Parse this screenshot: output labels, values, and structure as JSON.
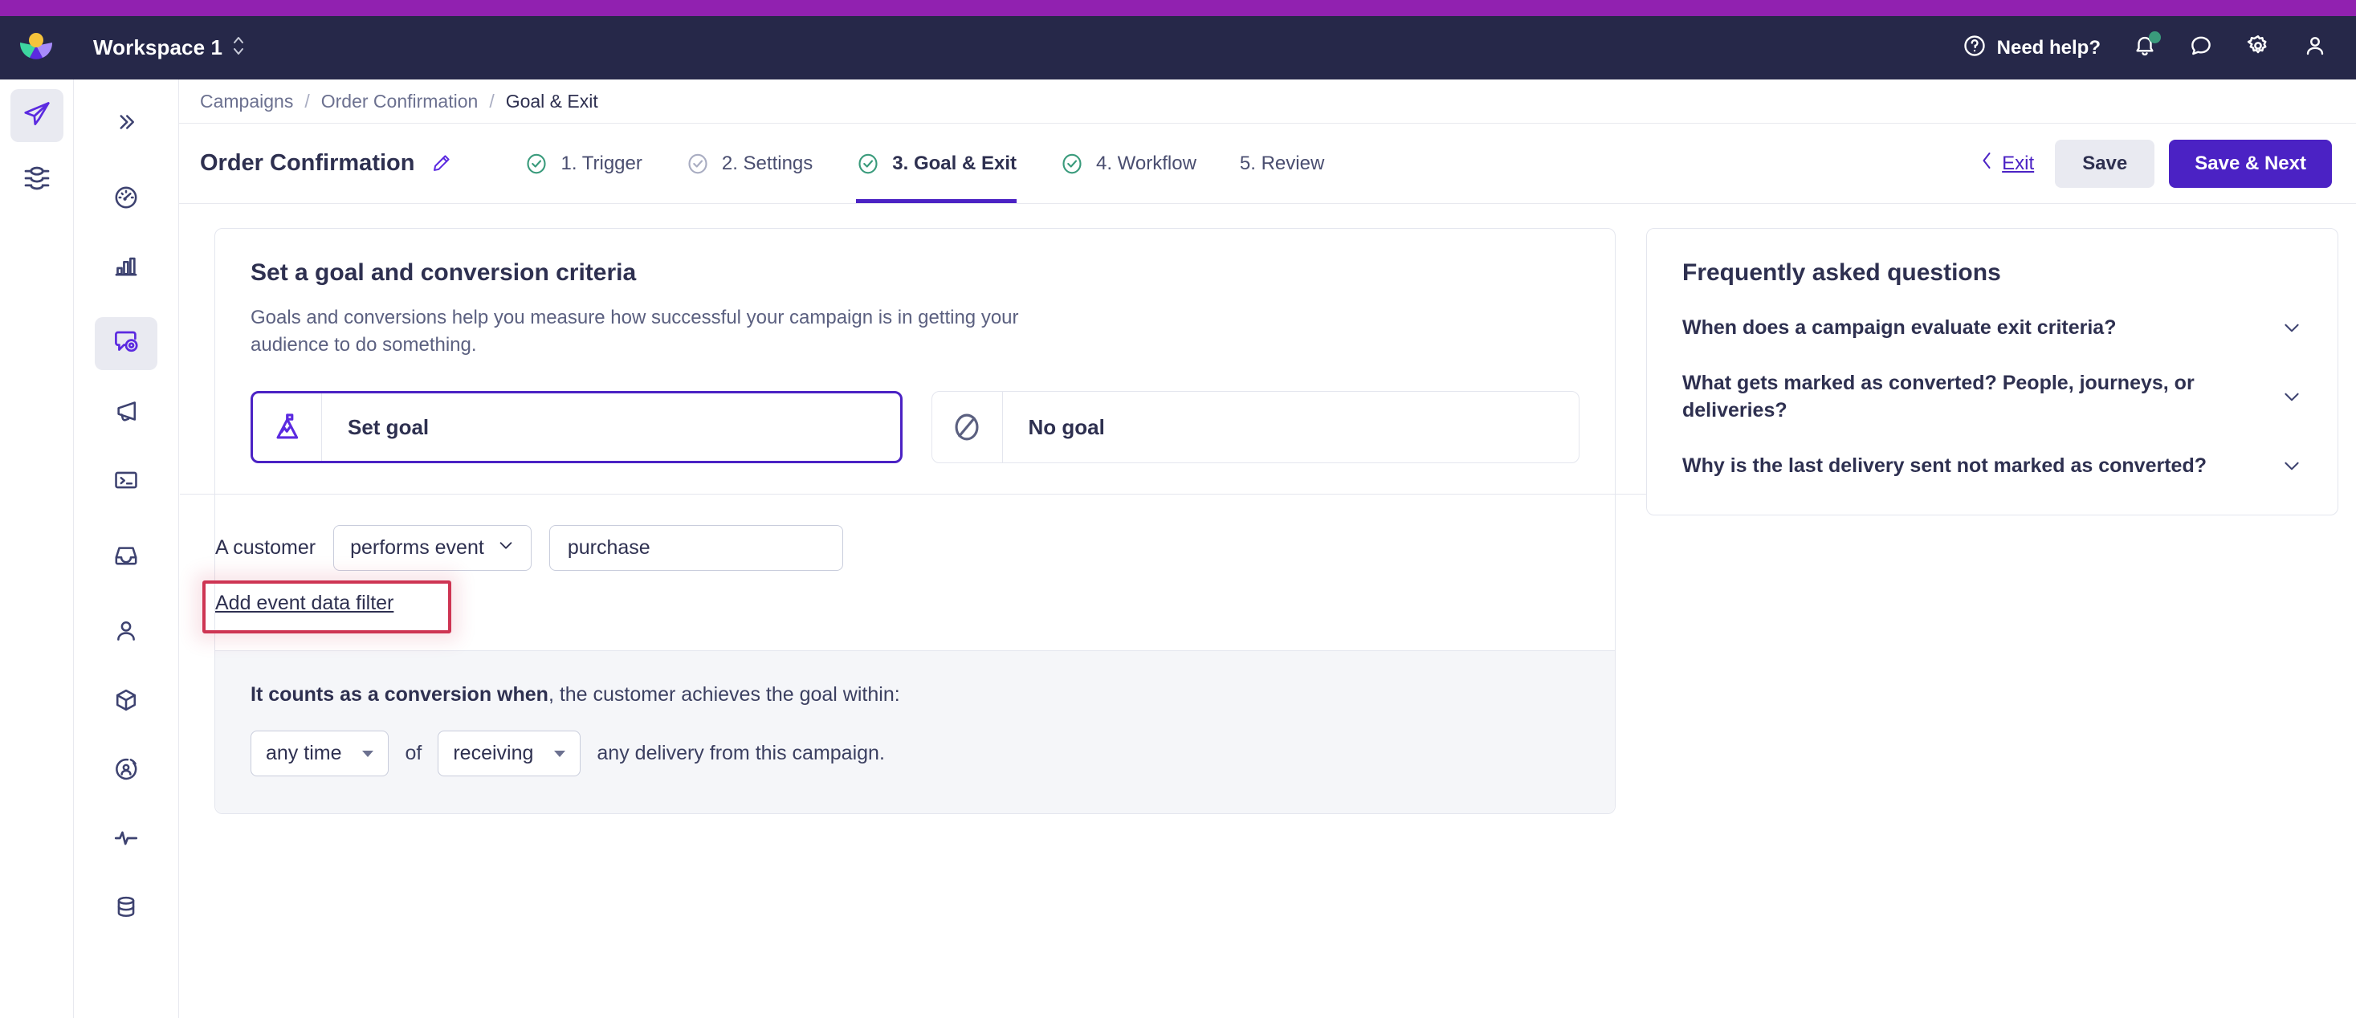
{
  "theme": {
    "accent_purple": "#9121B0",
    "nav_navy": "#262849",
    "brand_purple": "#4B22C4",
    "check_green": "#3A9B7C",
    "annotation_red": "#CE3553"
  },
  "global_nav": {
    "workspace_name": "Workspace 1",
    "need_help_label": "Need help?",
    "icons": {
      "help": "help-circle-icon",
      "notifications": "bell-icon",
      "chat": "chat-bubble-icon",
      "settings": "gear-icon",
      "account": "user-icon"
    }
  },
  "rail": {
    "items": [
      {
        "name": "paper-plane-icon",
        "active": true
      },
      {
        "name": "layers-data-icon",
        "active": false
      }
    ]
  },
  "sidebar": {
    "collapse_icon": "chevron-double-right-icon",
    "items": [
      {
        "name": "dashboard-gauge-icon",
        "active": false
      },
      {
        "name": "analytics-bar-chart-icon",
        "active": false
      },
      {
        "name": "campaigns-icon",
        "active": true
      },
      {
        "name": "broadcasts-megaphone-icon",
        "active": false
      },
      {
        "name": "transactional-terminal-icon",
        "active": false
      },
      {
        "name": "inbox-icon",
        "active": false
      },
      {
        "name": "people-person-icon",
        "active": false
      },
      {
        "name": "objects-box-icon",
        "active": false
      },
      {
        "name": "segments-icon",
        "active": false
      },
      {
        "name": "activity-pulse-icon",
        "active": false
      },
      {
        "name": "data-database-icon",
        "active": false
      }
    ]
  },
  "breadcrumb": {
    "items": [
      "Campaigns",
      "Order Confirmation",
      "Goal & Exit"
    ],
    "separator": "/"
  },
  "wizard": {
    "campaign_title": "Order Confirmation",
    "edit_icon": "pencil-icon",
    "steps": [
      {
        "label": "1. Trigger",
        "state": "complete"
      },
      {
        "label": "2. Settings",
        "state": "visited"
      },
      {
        "label": "3. Goal & Exit",
        "state": "current"
      },
      {
        "label": "4. Workflow",
        "state": "complete"
      },
      {
        "label": "5. Review",
        "state": "pending"
      }
    ],
    "exit_label": "Exit",
    "save_label": "Save",
    "save_next_label": "Save & Next"
  },
  "goal_card": {
    "title": "Set a goal and conversion criteria",
    "description": "Goals and conversions help you measure how successful your campaign is in getting your audience to do something.",
    "options": [
      {
        "label": "Set goal",
        "icon": "mountain-flag-icon",
        "selected": true
      },
      {
        "label": "No goal",
        "icon": "no-entry-icon",
        "selected": false
      }
    ],
    "criteria": {
      "prefix_text": "A customer",
      "condition_value": "performs event",
      "event_value": "purchase",
      "event_placeholder": "purchase",
      "add_filter_label": "Add event data filter"
    },
    "conversion": {
      "lead_bold": "It counts as a conversion when",
      "lead_rest": ", the customer achieves the goal within:",
      "window_value": "any time",
      "joiner": "of",
      "relation_value": "receiving",
      "tail_text": "any delivery from this campaign."
    }
  },
  "faq": {
    "title": "Frequently asked questions",
    "items": [
      {
        "question": "When does a campaign evaluate exit criteria?"
      },
      {
        "question": "What gets marked as converted? People, journeys, or deliveries?"
      },
      {
        "question": "Why is the last delivery sent not marked as converted?"
      }
    ],
    "chevron_icon": "chevron-down-icon"
  }
}
